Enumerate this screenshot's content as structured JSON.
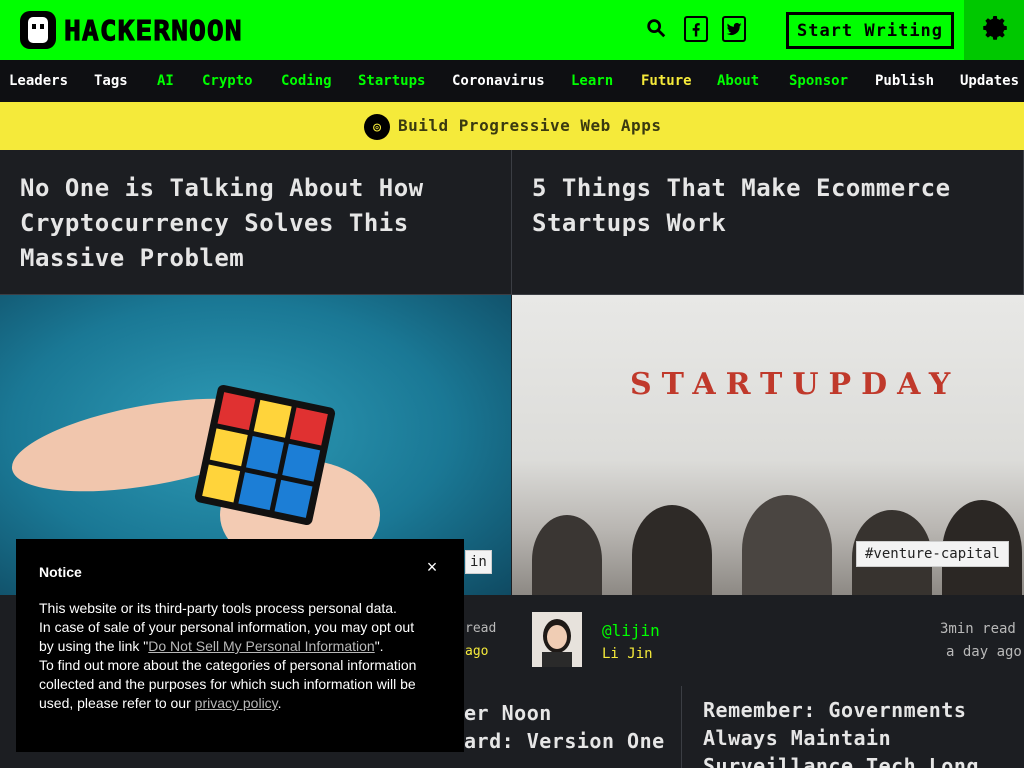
{
  "header": {
    "brand": "HACKERNOON",
    "cta_label": "Start Writing",
    "icons": [
      "search-icon",
      "facebook-icon",
      "twitter-icon",
      "gear-icon"
    ]
  },
  "nav": {
    "items": [
      {
        "label": "Leaders",
        "color": "#ffffff"
      },
      {
        "label": "Tags",
        "color": "#ffffff"
      },
      {
        "label": "AI",
        "color": "#00ff00"
      },
      {
        "label": "Crypto",
        "color": "#00ff00"
      },
      {
        "label": "Coding",
        "color": "#00ff00"
      },
      {
        "label": "Startups",
        "color": "#00ff00"
      },
      {
        "label": "Coronavirus",
        "color": "#ffffff"
      },
      {
        "label": "Learn",
        "color": "#00ff00"
      },
      {
        "label": "Future",
        "color": "#f5ea3a"
      },
      {
        "label": "About",
        "color": "#00ff00"
      },
      {
        "label": "Sponsor",
        "color": "#00ff00"
      },
      {
        "label": "Publish",
        "color": "#ffffff"
      },
      {
        "label": "Updates",
        "color": "#ffffff"
      }
    ]
  },
  "banner": {
    "link_text": "Build Progressive Web Apps"
  },
  "stories": [
    {
      "title_lines": [
        "No One is Talking About How",
        "Cryptocurrency Solves This",
        "Massive Problem"
      ]
    },
    {
      "title_lines": [
        "5 Things That Make Ecommerce",
        "Startups Work"
      ],
      "image_text": "STARTUPDAY",
      "tag": "#venture-capital",
      "author_handle": "@lijin",
      "author_name": "Li Jin",
      "read_time": "3min read",
      "posted": "a day ago"
    }
  ],
  "lower": {
    "left_title_line1": "er Noon",
    "left_title_line2": "ard: Version One",
    "right_title_lines": [
      "Remember: Governments",
      "Always Maintain",
      "Surveillance Tech Long"
    ]
  },
  "peek": {
    "left_read": "read",
    "left_ago": "ago",
    "left_tag": "in"
  },
  "notice": {
    "title": "Notice",
    "close_label": "×",
    "line1": "This website or its third-party tools process personal data.",
    "line2a": "In case of sale of your personal information, you may opt out by using the link \"",
    "link1": "Do Not Sell My Personal Information",
    "line2b": "\".",
    "line3a": "To find out more about the categories of personal information collected and the purposes for which such information will be used, please refer to our ",
    "link2": "privacy policy",
    "line3b": "."
  },
  "colors": {
    "brand_green": "#00ff00",
    "banner_yellow": "#f5ea3a",
    "dark_bg": "#1c1e22"
  }
}
